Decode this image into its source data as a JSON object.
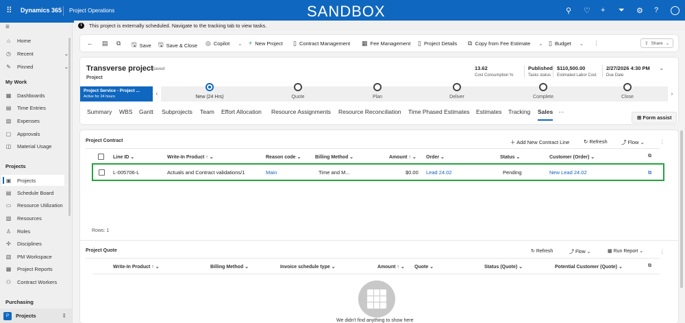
{
  "topbar": {
    "brand": "Dynamics 365",
    "app": "Project Operations",
    "environment": "SANDBOX",
    "icons": [
      "search-icon",
      "lightbulb-icon",
      "plus-icon",
      "filter-icon",
      "gear-icon",
      "help-icon",
      "avatar-icon"
    ]
  },
  "notification": "This project is externally scheduled. Navigate to the tracking tab to view tasks.",
  "sidebar": {
    "top": [
      {
        "label": "Home",
        "icon": "⌂"
      },
      {
        "label": "Recent",
        "icon": "◷"
      },
      {
        "label": "Pinned",
        "icon": "✎"
      }
    ],
    "groups": [
      {
        "title": "My Work",
        "items": [
          {
            "label": "Dashboards",
            "icon": "▦"
          },
          {
            "label": "Time Entries",
            "icon": "▤"
          },
          {
            "label": "Expenses",
            "icon": "▧"
          },
          {
            "label": "Approvals",
            "icon": "▢"
          },
          {
            "label": "Material Usage",
            "icon": "◫"
          }
        ]
      },
      {
        "title": "Projects",
        "items": [
          {
            "label": "Projects",
            "icon": "▣"
          },
          {
            "label": "Schedule Board",
            "icon": "▤"
          },
          {
            "label": "Resource Utilization",
            "icon": "▭"
          },
          {
            "label": "Resources",
            "icon": "▧"
          },
          {
            "label": "Roles",
            "icon": "♙"
          },
          {
            "label": "Disciplines",
            "icon": "✣"
          },
          {
            "label": "PM Workspace",
            "icon": "▥"
          },
          {
            "label": "Project Reports",
            "icon": "▦"
          },
          {
            "label": "Contract Workers",
            "icon": "⚇"
          }
        ]
      },
      {
        "title": "Purchasing",
        "items": []
      }
    ],
    "area": {
      "letter": "P",
      "label": "Projects"
    }
  },
  "commands": [
    "Save",
    "Save & Close",
    "Copilot",
    "New Project",
    "Contract Management",
    "Fee Management",
    "Project Details",
    "Copy from Fee Estimate",
    "Budget"
  ],
  "share": "Share",
  "header": {
    "title": "Transverse project",
    "saved": "- Saved",
    "entity": "Project",
    "stats": [
      {
        "value": "13.62",
        "label": "Cost Consumption %"
      },
      {
        "value": "Published",
        "label": "Tasks status"
      },
      {
        "value": "$110,500.00",
        "label": "Estimated Labor Cost"
      },
      {
        "value": "2/27/2026 4:30 PM",
        "label": "Due Date"
      }
    ]
  },
  "bpf": {
    "name": "Project Service - Project ...",
    "active": "Active for 24 hours",
    "stages": [
      "New  (24 Hrs)",
      "Quote",
      "Plan",
      "Deliver",
      "Complete",
      "Close"
    ]
  },
  "tabs": [
    "Summary",
    "WBS",
    "Gantt",
    "Subprojects",
    "Team",
    "Effort Allocation",
    "Resource Assignments",
    "Resource Reconciliation",
    "Time Phased Estimates",
    "Estimates",
    "Tracking",
    "Sales",
    "···"
  ],
  "active_tab": "Sales",
  "form_assist": "Form assist",
  "contract": {
    "title": "Project Contract",
    "actions": [
      "Add New Contract Line",
      "Refresh",
      "Flow"
    ],
    "columns": [
      "Line ID ⌄",
      "Write-In Product ↑ ⌄",
      "Reason code ⌄",
      "Billing Method ⌄",
      "Amount ↑ ⌄",
      "Order ⌄",
      "Status ⌄",
      "Customer (Order) ⌄"
    ],
    "rows": [
      {
        "line_id": "L-005706-L",
        "product": "Actuals and Contract validations/1",
        "reason": "Main",
        "billing": "Time and M...",
        "amount": "$0.00",
        "order": "Lead 24.02",
        "status": "Pending",
        "customer": "New Lead 24.02"
      }
    ],
    "rows_count": "Rows: 1",
    "highlight_color": "#22a33a"
  },
  "quote": {
    "title": "Project Quote",
    "actions": [
      "Refresh",
      "Flow",
      "Run Report"
    ],
    "columns": [
      "Write-In Product ↑ ⌄",
      "Billing Method ⌄",
      "Invoice schedule type ⌄",
      "Amount ↑ ⌄",
      "Quote ⌄",
      "Status (Quote) ⌄",
      "Potential Customer (Quote) ⌄"
    ],
    "empty": "We didn't find anything to show here"
  }
}
